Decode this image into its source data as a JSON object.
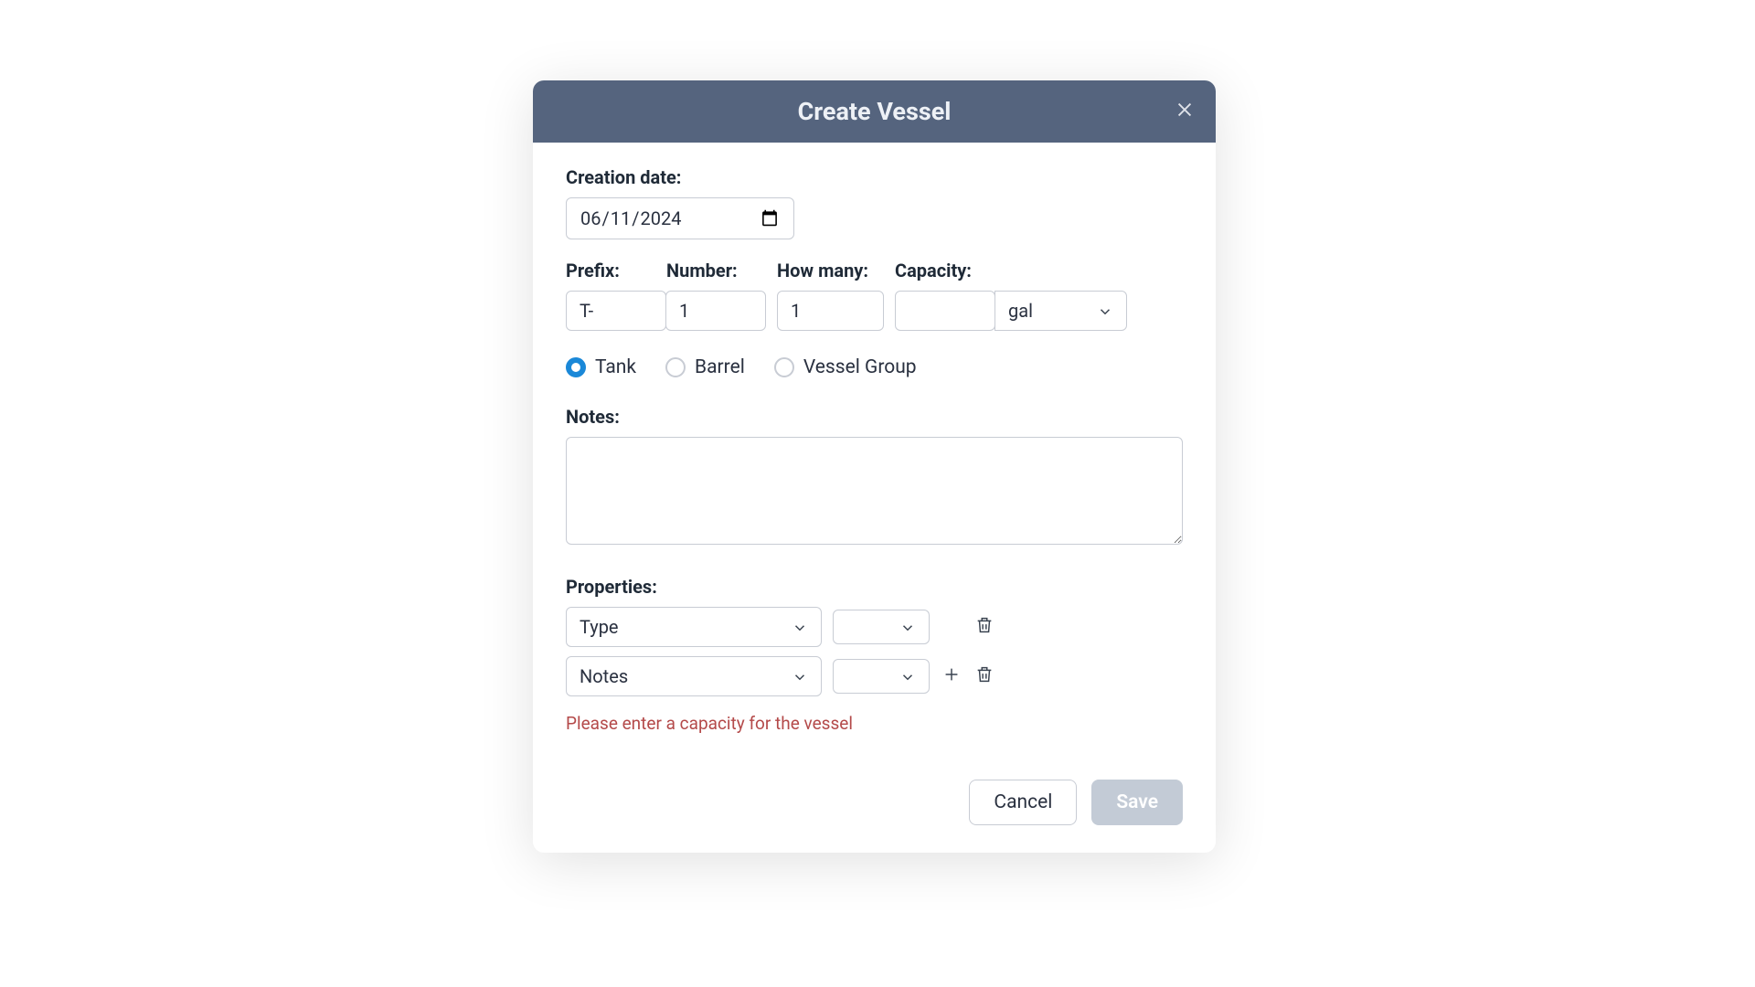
{
  "modal": {
    "title": "Create Vessel",
    "labels": {
      "creation_date": "Creation date:",
      "prefix": "Prefix:",
      "number": "Number:",
      "how_many": "How many:",
      "capacity": "Capacity:",
      "notes": "Notes:",
      "properties": "Properties:"
    },
    "values": {
      "creation_date": "2024-06-11",
      "prefix": "T-",
      "number": "1",
      "how_many": "1",
      "capacity": "",
      "capacity_unit": "gal"
    },
    "vessel_type": {
      "options": [
        "Tank",
        "Barrel",
        "Vessel Group"
      ],
      "selected": "Tank"
    },
    "notes_value": "",
    "properties_rows": [
      {
        "key": "Type",
        "value": ""
      },
      {
        "key": "Notes",
        "value": ""
      }
    ],
    "error": "Please enter a capacity for the vessel",
    "footer": {
      "cancel": "Cancel",
      "save": "Save"
    }
  }
}
